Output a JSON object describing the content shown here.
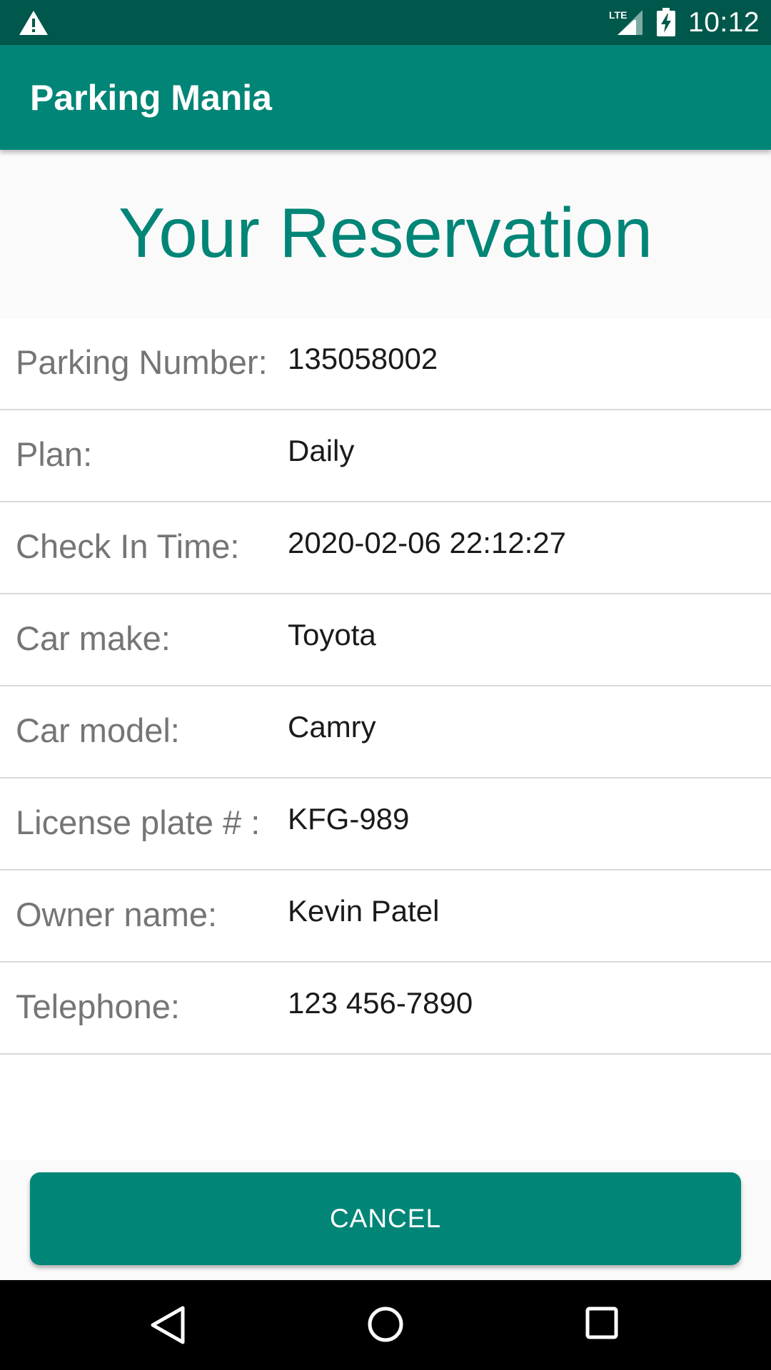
{
  "status_bar": {
    "time": "10:12",
    "network": "LTE",
    "icons": [
      "warning-icon",
      "lte-signal-icon",
      "battery-charging-icon"
    ]
  },
  "app_bar": {
    "title": "Parking Mania"
  },
  "page": {
    "title": "Your Reservation"
  },
  "details": [
    {
      "label": "Parking Number:",
      "value": "135058002"
    },
    {
      "label": "Plan:",
      "value": "Daily"
    },
    {
      "label": "Check In Time:",
      "value": "2020-02-06 22:12:27"
    },
    {
      "label": "Car make:",
      "value": "Toyota"
    },
    {
      "label": "Car model:",
      "value": "Camry"
    },
    {
      "label": "License plate # :",
      "value": "KFG-989"
    },
    {
      "label": "Owner name:",
      "value": "Kevin Patel"
    },
    {
      "label": "Telephone:",
      "value": "123 456-7890"
    }
  ],
  "actions": {
    "cancel_label": "CANCEL"
  },
  "nav_bar": {
    "icons": [
      "back-icon",
      "home-icon",
      "recents-icon"
    ]
  },
  "colors": {
    "primary": "#008577",
    "primary_dark": "#00574b",
    "label_text": "#757575",
    "value_text": "#1a1a1a",
    "divider": "#d9d9d9"
  }
}
